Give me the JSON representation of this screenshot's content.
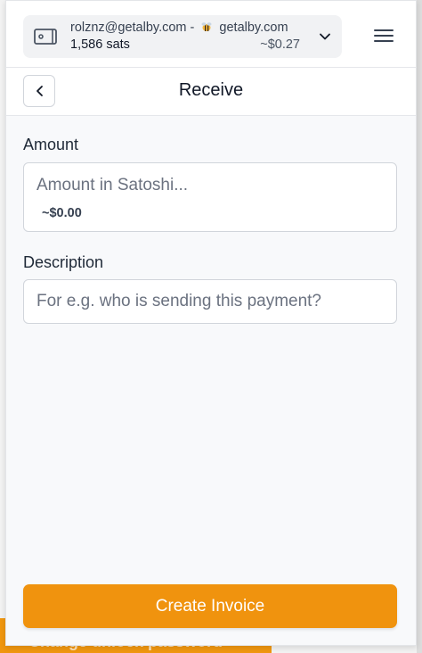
{
  "account": {
    "name_prefix": "rolznz@getalby.com -",
    "lightning_domain": "getalby.com",
    "balance_sats": "1,586 sats",
    "balance_fiat": "~$0.27"
  },
  "header": {
    "title": "Receive"
  },
  "form": {
    "amount_label": "Amount",
    "amount_placeholder": "Amount in Satoshi...",
    "amount_fiat": "~$0.00",
    "description_label": "Description",
    "description_placeholder": "For e.g. who is sending this payment?"
  },
  "actions": {
    "create_invoice_label": "Create Invoice"
  },
  "background": {
    "peeking_text": "Change unlock password"
  },
  "colors": {
    "accent": "#f0930e"
  }
}
